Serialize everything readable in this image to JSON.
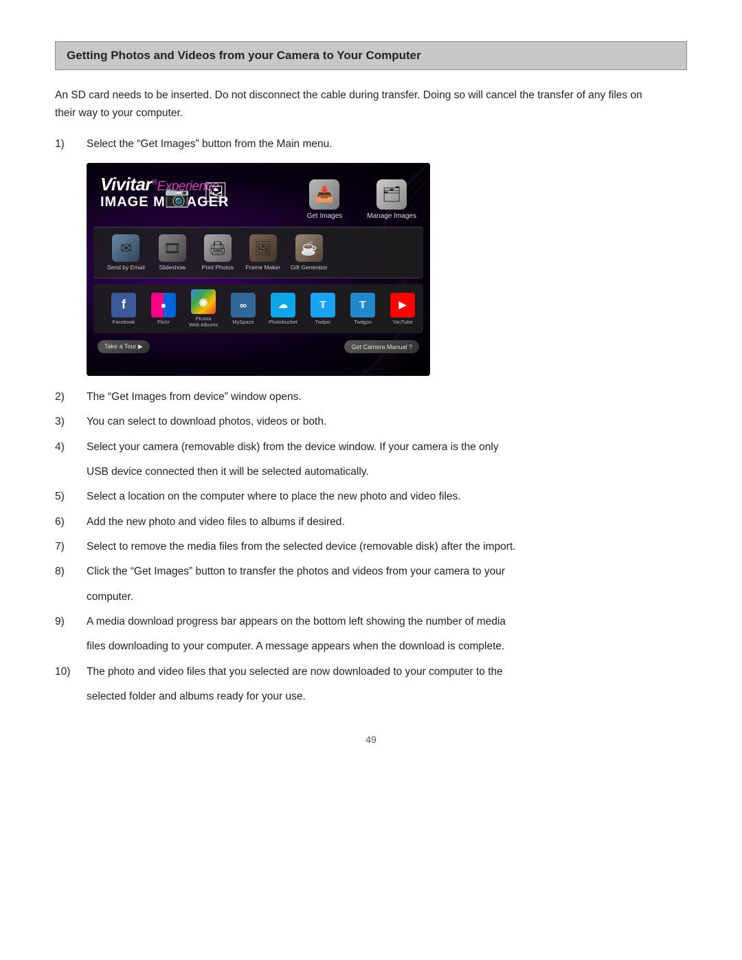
{
  "page": {
    "page_number": "49"
  },
  "heading": {
    "title": "Getting Photos and Videos from your Camera to Your Computer"
  },
  "intro": {
    "paragraph": "An SD card needs to be inserted. Do not disconnect the cable during transfer. Doing so will cancel the transfer of any files on their way to your computer."
  },
  "steps": [
    {
      "number": "1)",
      "text": "Select the “Get Images” button from the Main menu."
    },
    {
      "number": "2)",
      "text": "The “Get Images from device” window opens."
    },
    {
      "number": "3)",
      "text": "You can select to download photos, videos or both."
    },
    {
      "number": "4a)",
      "text": "Select your camera (removable disk) from the device window. If your camera is the only"
    },
    {
      "number": "4b)",
      "text": "USB device connected then it will be selected automatically."
    },
    {
      "number": "5)",
      "text": "Select a location on the computer where to place the new photo and video files."
    },
    {
      "number": "6)",
      "text": "Add the new photo and video files to albums if desired."
    },
    {
      "number": "7)",
      "text": "Select to remove the media files from the selected device (removable disk) after the import."
    },
    {
      "number": "8a)",
      "text": "Click the “Get Images” button to transfer the photos and videos from your camera to your"
    },
    {
      "number": "8b)",
      "text": "computer."
    },
    {
      "number": "9a)",
      "text": "A media download progress bar appears on the bottom left showing the number of media"
    },
    {
      "number": "9b)",
      "text": "files downloading to your computer. A message appears when the download is complete."
    },
    {
      "number": "10a)",
      "text": "The photo and video files that you selected are now downloaded to your computer to the"
    },
    {
      "number": "10b)",
      "text": "selected folder and albums ready for your use."
    }
  ],
  "screenshot": {
    "logo_vivitar": "Vivitar",
    "logo_exp": "Experience",
    "logo_im": "IMAGE MANAGER",
    "header_btn1_label": "Get Images",
    "header_btn2_label": "Manage Images",
    "menu_items": [
      {
        "label": "Send by Email",
        "icon": "✉"
      },
      {
        "label": "Slideshow",
        "icon": "▶"
      },
      {
        "label": "Print Photos",
        "icon": "🖨"
      },
      {
        "label": "Frame Maker",
        "icon": "🖼"
      },
      {
        "label": "Gift Generator",
        "icon": "☕"
      }
    ],
    "social_items": [
      {
        "label": "Facebook",
        "icon": "f",
        "bg": "#3b5998"
      },
      {
        "label": "Flickr",
        "icon": "✿",
        "bg": "#ff0084"
      },
      {
        "label": "Picasa\nWeb Albums",
        "icon": "◉",
        "bg": "#336699"
      },
      {
        "label": "MySpace",
        "icon": "∞",
        "bg": "#336699"
      },
      {
        "label": "Photobucket",
        "icon": "☁",
        "bg": "#0ea5e9"
      },
      {
        "label": "Twitpic",
        "icon": "🐦",
        "bg": "#1da1f2"
      },
      {
        "label": "Twitgoo",
        "icon": "🐦",
        "bg": "#1da1f2"
      },
      {
        "label": "YouTube",
        "icon": "▶",
        "bg": "#ff0000"
      }
    ],
    "bottom_btn1": "Take a Tour ▶",
    "bottom_btn2": "Get Camera Manual ?"
  }
}
